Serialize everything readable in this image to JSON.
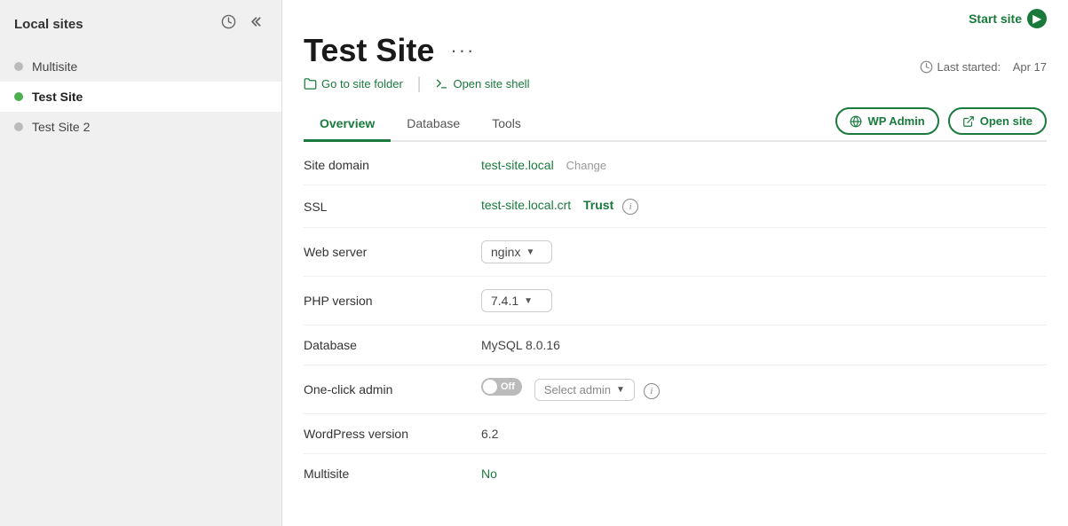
{
  "sidebar": {
    "title": "Local sites",
    "items": [
      {
        "id": "multisite",
        "label": "Multisite",
        "status": "gray"
      },
      {
        "id": "test-site",
        "label": "Test Site",
        "status": "green",
        "active": true
      },
      {
        "id": "test-site-2",
        "label": "Test Site 2",
        "status": "gray"
      }
    ]
  },
  "header": {
    "start_site_label": "Start site",
    "last_started_label": "Last started:",
    "last_started_date": "Apr 17"
  },
  "site": {
    "title": "Test Site",
    "more_icon": "···",
    "go_to_folder_label": "Go to site folder",
    "open_shell_label": "Open site shell"
  },
  "tabs": [
    {
      "id": "overview",
      "label": "Overview",
      "active": true
    },
    {
      "id": "database",
      "label": "Database",
      "active": false
    },
    {
      "id": "tools",
      "label": "Tools",
      "active": false
    }
  ],
  "tab_actions": {
    "wp_admin_label": "WP Admin",
    "open_site_label": "Open site"
  },
  "overview": {
    "rows": [
      {
        "label": "Site domain",
        "value": "test-site.local",
        "extra": "Change",
        "type": "domain"
      },
      {
        "label": "SSL",
        "value": "test-site.local.crt",
        "extra": "Trust",
        "type": "ssl"
      },
      {
        "label": "Web server",
        "value": "nginx",
        "type": "dropdown"
      },
      {
        "label": "PHP version",
        "value": "7.4.1",
        "type": "dropdown"
      },
      {
        "label": "Database",
        "value": "MySQL 8.0.16",
        "type": "text"
      },
      {
        "label": "One-click admin",
        "toggle": "Off",
        "selectLabel": "Select admin",
        "type": "toggle"
      },
      {
        "label": "WordPress version",
        "value": "6.2",
        "type": "text"
      },
      {
        "label": "Multisite",
        "value": "No",
        "type": "green-text"
      }
    ]
  },
  "colors": {
    "green": "#1a7a3c",
    "light_green_text": "#2e7d52"
  }
}
